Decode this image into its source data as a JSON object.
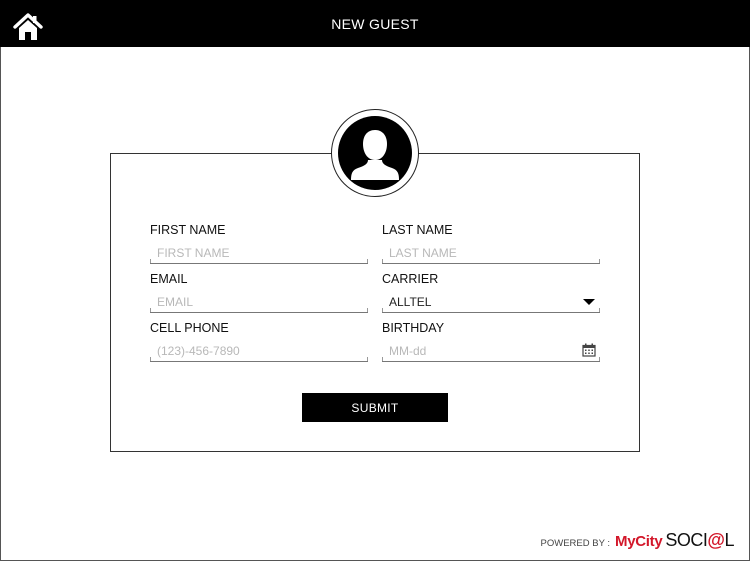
{
  "header": {
    "title": "NEW GUEST",
    "home_icon": "home-icon"
  },
  "avatar": {
    "icon": "user-silhouette-icon"
  },
  "form": {
    "first_name": {
      "label": "FIRST NAME",
      "placeholder": "FIRST NAME",
      "value": ""
    },
    "last_name": {
      "label": "LAST NAME",
      "placeholder": "LAST NAME",
      "value": ""
    },
    "email": {
      "label": "EMAIL",
      "placeholder": "EMAIL",
      "value": ""
    },
    "carrier": {
      "label": "CARRIER",
      "selected": "ALLTEL",
      "icon": "dropdown-caret-icon"
    },
    "cell_phone": {
      "label": "CELL PHONE",
      "placeholder": "(123)-456-7890",
      "value": ""
    },
    "birthday": {
      "label": "BIRTHDAY",
      "placeholder": "MM-dd",
      "value": "",
      "icon": "calendar-icon"
    },
    "submit_label": "SUBMIT"
  },
  "footer": {
    "powered_by": "POWERED BY :",
    "brand_part1": "MyCity",
    "brand_part2a": "SOCI",
    "brand_at": "@",
    "brand_part2b": "L",
    "brand_color": "#d3172a"
  }
}
